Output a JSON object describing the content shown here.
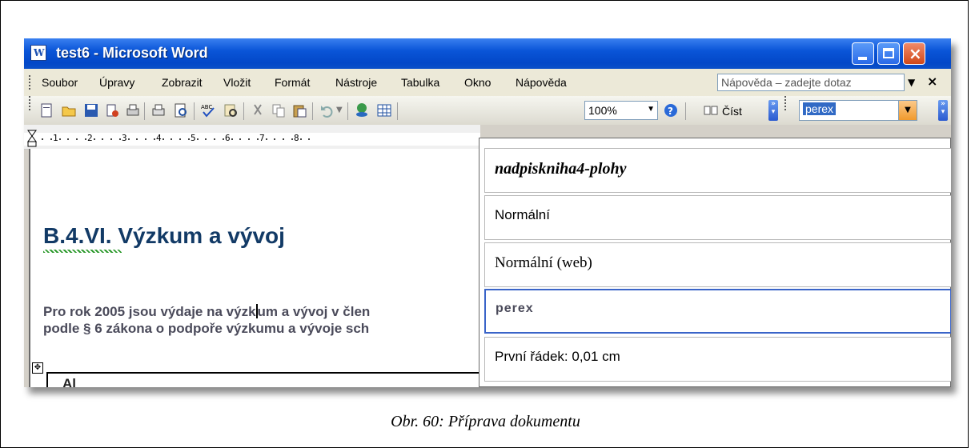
{
  "window": {
    "title": "test6 - Microsoft Word",
    "app_icon": "word-icon"
  },
  "menubar": {
    "items": [
      {
        "label": "Soubor"
      },
      {
        "label": "Úpravy"
      },
      {
        "label": "Zobrazit"
      },
      {
        "label": "Vložit"
      },
      {
        "label": "Formát"
      },
      {
        "label": "Nástroje"
      },
      {
        "label": "Tabulka"
      },
      {
        "label": "Okno"
      },
      {
        "label": "Nápověda"
      }
    ],
    "help_placeholder": "Nápověda – zadejte dotaz"
  },
  "toolbar": {
    "zoom": "100%",
    "read_label": "Číst",
    "style_value": "perex",
    "icons": [
      "new-icon",
      "open-icon",
      "save-icon",
      "permission-icon",
      "print-preview-icon",
      "print-icon",
      "preview-icon",
      "spelling-icon",
      "research-icon",
      "cut-icon",
      "copy-icon",
      "paste-icon",
      "undo-icon",
      "hyperlink-icon",
      "table-icon",
      "help-icon",
      "read-icon"
    ]
  },
  "ruler": {
    "numbers": [
      "1",
      "2",
      "3",
      "4",
      "5",
      "6",
      "7",
      "8"
    ]
  },
  "document": {
    "heading": "B.4.VI. Výzkum a vývoj",
    "para_line1_a": "Pro rok 2005 jsou výdaje na výzk",
    "para_line1_b": "um a vývoj v člen",
    "para_line2": "podle § 6 zákona o podpoře výzkumu a vývoje sch",
    "cutoff": "Al"
  },
  "style_dropdown": {
    "items": [
      {
        "label": "nadpiskniha4-plohy"
      },
      {
        "label": "Normální"
      },
      {
        "label": "Normální (web)"
      },
      {
        "label": "perex",
        "selected": true
      },
      {
        "label": "První řádek:  0,01 cm"
      }
    ]
  },
  "caption": "Obr. 60: Příprava dokumentu",
  "colors": {
    "titlebar": "#0a55d8",
    "heading": "#123a66",
    "selection": "#316ac5"
  }
}
